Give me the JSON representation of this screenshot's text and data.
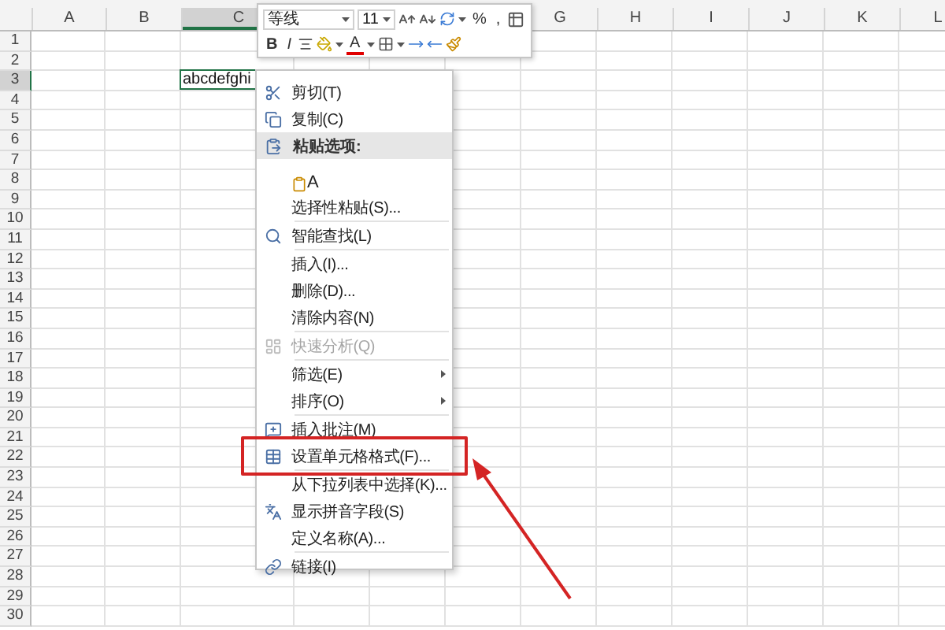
{
  "sheet": {
    "columns_left": [
      {
        "label": "A",
        "selected": false
      },
      {
        "label": "B",
        "selected": false
      },
      {
        "label": "C",
        "selected": true
      }
    ],
    "columns_right": [
      {
        "label": "G",
        "selected": false
      },
      {
        "label": "H",
        "selected": false
      },
      {
        "label": "I",
        "selected": false
      },
      {
        "label": "J",
        "selected": false
      },
      {
        "label": "K",
        "selected": false
      },
      {
        "label": "L",
        "selected": false
      }
    ],
    "rows": [
      {
        "label": "1",
        "selected": false
      },
      {
        "label": "2",
        "selected": false
      },
      {
        "label": "3",
        "selected": true
      },
      {
        "label": "4",
        "selected": false
      },
      {
        "label": "5",
        "selected": false
      },
      {
        "label": "6",
        "selected": false
      },
      {
        "label": "7",
        "selected": false
      },
      {
        "label": "8",
        "selected": false
      },
      {
        "label": "9",
        "selected": false
      },
      {
        "label": "10",
        "selected": false
      },
      {
        "label": "11",
        "selected": false
      },
      {
        "label": "12",
        "selected": false
      },
      {
        "label": "13",
        "selected": false
      },
      {
        "label": "14",
        "selected": false
      },
      {
        "label": "15",
        "selected": false
      },
      {
        "label": "16",
        "selected": false
      },
      {
        "label": "17",
        "selected": false
      },
      {
        "label": "18",
        "selected": false
      },
      {
        "label": "19",
        "selected": false
      },
      {
        "label": "20",
        "selected": false
      },
      {
        "label": "21",
        "selected": false
      },
      {
        "label": "22",
        "selected": false
      },
      {
        "label": "23",
        "selected": false
      },
      {
        "label": "24",
        "selected": false
      },
      {
        "label": "25",
        "selected": false
      },
      {
        "label": "26",
        "selected": false
      },
      {
        "label": "27",
        "selected": false
      },
      {
        "label": "28",
        "selected": false
      },
      {
        "label": "29",
        "selected": false
      },
      {
        "label": "30",
        "selected": false
      }
    ],
    "active_cell": {
      "value": "abcdefghi"
    }
  },
  "mini_toolbar": {
    "font_name": "等线",
    "font_size": "11",
    "percent": "%",
    "comma": ",",
    "bold": "B",
    "italic": "I",
    "font_color": "A"
  },
  "context_menu": {
    "groups": [
      [
        {
          "kind": "item",
          "label": "剪切(T)",
          "disabled": false,
          "submenu": false,
          "highlighted": false
        },
        {
          "kind": "item",
          "label": "复制(C)",
          "disabled": false,
          "submenu": false,
          "highlighted": false
        },
        {
          "kind": "heading",
          "label": "粘贴选项:"
        },
        {
          "kind": "paste-option",
          "label": "A"
        },
        {
          "kind": "item",
          "label": "选择性粘贴(S)...",
          "disabled": false,
          "submenu": false,
          "highlighted": false
        }
      ],
      [
        {
          "kind": "item",
          "label": "智能查找(L)",
          "disabled": false,
          "submenu": false,
          "highlighted": false
        }
      ],
      [
        {
          "kind": "item",
          "label": "插入(I)...",
          "disabled": false,
          "submenu": false,
          "highlighted": false
        },
        {
          "kind": "item",
          "label": "删除(D)...",
          "disabled": false,
          "submenu": false,
          "highlighted": false
        },
        {
          "kind": "item",
          "label": "清除内容(N)",
          "disabled": false,
          "submenu": false,
          "highlighted": false
        }
      ],
      [
        {
          "kind": "item",
          "label": "快速分析(Q)",
          "disabled": true,
          "submenu": false,
          "highlighted": false
        }
      ],
      [
        {
          "kind": "item",
          "label": "筛选(E)",
          "disabled": false,
          "submenu": true,
          "highlighted": false
        },
        {
          "kind": "item",
          "label": "排序(O)",
          "disabled": false,
          "submenu": true,
          "highlighted": false
        }
      ],
      [
        {
          "kind": "item",
          "label": "插入批注(M)",
          "disabled": false,
          "submenu": false,
          "highlighted": false
        },
        {
          "kind": "item",
          "label": "设置单元格格式(F)...",
          "disabled": false,
          "submenu": false,
          "highlighted": true
        }
      ],
      [
        {
          "kind": "item",
          "label": "从下拉列表中选择(K)...",
          "disabled": false,
          "submenu": false,
          "highlighted": false
        },
        {
          "kind": "item",
          "label": "显示拼音字段(S)",
          "disabled": false,
          "submenu": false,
          "highlighted": false
        },
        {
          "kind": "item",
          "label": "定义名称(A)...",
          "disabled": false,
          "submenu": false,
          "highlighted": false
        }
      ],
      [
        {
          "kind": "item",
          "label": "链接(I)",
          "disabled": false,
          "submenu": false,
          "highlighted": false
        }
      ]
    ]
  },
  "annotations": [
    {
      "kind": "arrow"
    }
  ]
}
